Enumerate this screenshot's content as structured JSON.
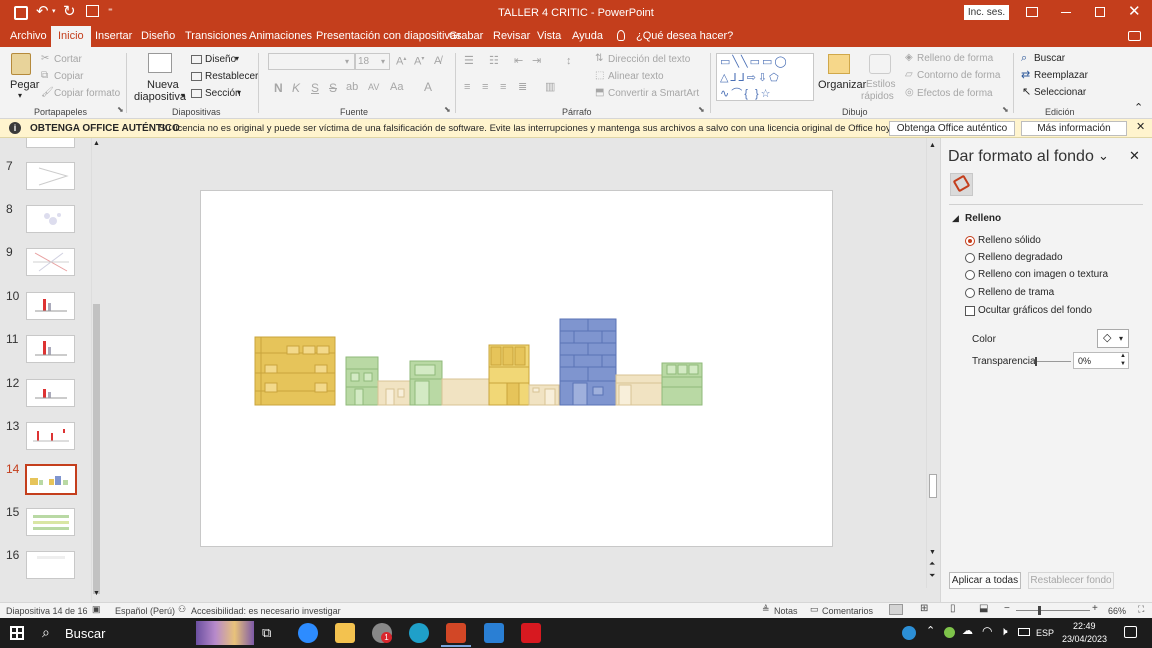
{
  "titlebar": {
    "doc_title": "TALLER 4 CRITIC",
    "app_sep": " - ",
    "app_name": "PowerPoint",
    "signin": "Inc. ses."
  },
  "menu": {
    "tabs": [
      "Archivo",
      "Inicio",
      "Insertar",
      "Diseño",
      "Transiciones",
      "Animaciones",
      "Presentación con diapositivas",
      "Grabar",
      "Revisar",
      "Vista",
      "Ayuda"
    ],
    "tell_me": "¿Qué desea hacer?"
  },
  "ribbon": {
    "clipboard": {
      "paste": "Pegar",
      "cut": "Cortar",
      "copy": "Copiar",
      "format_painter": "Copiar formato",
      "group": "Portapapeles"
    },
    "slides": {
      "new_slide_1": "Nueva",
      "new_slide_2": "diapositiva",
      "layout": "Diseño",
      "reset": "Restablecer",
      "section": "Sección",
      "group": "Diapositivas"
    },
    "font": {
      "size": "18",
      "bold": "N",
      "italic": "K",
      "underline": "S",
      "strike": "S",
      "shadow": "ab",
      "spacing": "AV",
      "case": "Aa",
      "color": "A",
      "group": "Fuente"
    },
    "paragraph": {
      "text_direction": "Dirección del texto",
      "align_text": "Alinear texto",
      "smartart": "Convertir a SmartArt",
      "group": "Párrafo"
    },
    "drawing": {
      "arrange": "Organizar",
      "styles_1": "Estilos",
      "styles_2": "rápidos",
      "shape_fill": "Relleno de forma",
      "shape_outline": "Contorno de forma",
      "shape_effects": "Efectos de forma",
      "group": "Dibujo"
    },
    "editing": {
      "find": "Buscar",
      "replace": "Reemplazar",
      "select": "Seleccionar",
      "group": "Edición"
    }
  },
  "notice": {
    "title": "OBTENGA OFFICE AUTÉNTICO",
    "message": "Su licencia no es original y puede ser víctima de una falsificación de software. Evite las interrupciones y mantenga sus archivos a salvo con una licencia original de Office hoy mismo.",
    "btn_get": "Obtenga Office auténtico",
    "btn_more": "Más información"
  },
  "thumbnails": [
    {
      "num": "7"
    },
    {
      "num": "8"
    },
    {
      "num": "9"
    },
    {
      "num": "10"
    },
    {
      "num": "11"
    },
    {
      "num": "12"
    },
    {
      "num": "13"
    },
    {
      "num": "14"
    },
    {
      "num": "15"
    },
    {
      "num": "16"
    }
  ],
  "pane": {
    "title": "Dar formato al fondo",
    "section": "Relleno",
    "options": [
      "Relleno sólido",
      "Relleno degradado",
      "Relleno con imagen o textura",
      "Relleno de trama"
    ],
    "hide_graphics": "Ocultar gráficos del fondo",
    "color_label": "Color",
    "transparency_label": "Transparencia",
    "transparency_value": "0%",
    "apply_all": "Aplicar a todas",
    "reset_bg": "Restablecer fondo"
  },
  "status": {
    "slide_info": "Diapositiva 14 de 16",
    "language": "Español (Perú)",
    "accessibility": "Accesibilidad: es necesario investigar",
    "notes": "Notas",
    "comments": "Comentarios",
    "zoom": "66%"
  },
  "taskbar": {
    "search": "Buscar",
    "badge": "1",
    "lang": "ESP",
    "time": "22:49",
    "date": "23/04/2023"
  },
  "colors": {
    "accent": "#c43e1c",
    "selected_thumb": "#c43e1c",
    "yellow": "#e6c45a",
    "green": "#b9d9a4",
    "blue": "#7f95cf",
    "beige": "#f1e3c2"
  }
}
